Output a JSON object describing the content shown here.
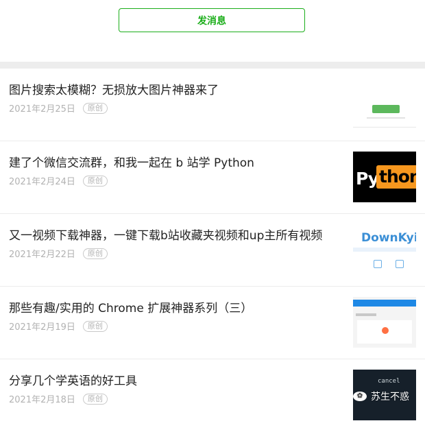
{
  "send_button": {
    "label": "发消息"
  },
  "articles": [
    {
      "title": "图片搜索太模糊？无损放大图片神器来了",
      "date": "2021年2月25日",
      "badge": "原创",
      "thumb": "image-upscale-screenshot"
    },
    {
      "title": "建了个微信交流群，和我一起在 b 站学 Python",
      "date": "2021年2月24日",
      "badge": "原创",
      "thumb": "python-logo",
      "thumb_text": {
        "white": "Py",
        "orange": "thon"
      }
    },
    {
      "title": "又一视频下载神器，一键下载b站收藏夹视频和up主所有视频",
      "date": "2021年2月22日",
      "badge": "原创",
      "thumb": "downkyi-screenshot",
      "thumb_text": {
        "logo": "DownKyi"
      }
    },
    {
      "title": "那些有趣/实用的 Chrome 扩展神器系列（三）",
      "date": "2021年2月19日",
      "badge": "原创",
      "thumb": "chrome-extension-screenshot"
    },
    {
      "title": "分享几个学英语的好工具",
      "date": "2021年2月18日",
      "badge": "原创",
      "thumb": "english-tool-screenshot",
      "thumb_text": {
        "text": "cancel"
      }
    }
  ],
  "watermark": {
    "text": "苏生不惑",
    "icon": "wechat-icon"
  },
  "colors": {
    "accent": "#1aad19",
    "date": "#b2b2b2",
    "separator": "#ededed"
  }
}
